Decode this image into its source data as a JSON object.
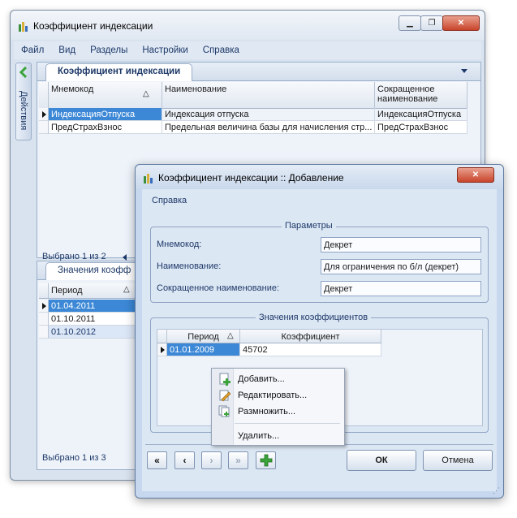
{
  "main_window": {
    "title": "Коэффициент индексации",
    "menu": [
      "Файл",
      "Вид",
      "Разделы",
      "Настройки",
      "Справка"
    ],
    "side_tab": "Действия",
    "top_panel": {
      "tab": "Коэффициент индексации",
      "columns": [
        "Мнемокод",
        "Наименование",
        "Сокращенное наименование"
      ],
      "rows": [
        [
          "ИндексацияОтпуска",
          "Индексация отпуска",
          "ИндексацияОтпуска"
        ],
        [
          "ПредСтрахВзнос",
          "Предельная величина базы для начисления стр...",
          "ПредСтрахВзнос"
        ]
      ],
      "footer": "Выбрано 1 из 2"
    },
    "bottom_panel": {
      "tab": "Значения коэфф",
      "column": "Период",
      "rows": [
        "01.04.2011",
        "01.10.2011",
        "01.10.2012"
      ],
      "footer": "Выбрано 1 из 3"
    }
  },
  "dialog": {
    "title": "Коэффициент индексации :: Добавление",
    "menu": "Справка",
    "params_legend": "Параметры",
    "fields": [
      {
        "label": "Мнемокод:",
        "value": "Декрет"
      },
      {
        "label": "Наименование:",
        "value": "Для ограничения по б/л (декрет)"
      },
      {
        "label": "Сокращенное наименование:",
        "value": "Декрет"
      }
    ],
    "values_legend": "Значения коэффициентов",
    "values_columns": [
      "Период",
      "Коэффициент"
    ],
    "values_rows": [
      [
        "01.01.2009",
        "45702"
      ]
    ],
    "ok": "ОК",
    "cancel": "Отмена"
  },
  "context_menu": {
    "items": [
      "Добавить...",
      "Редактировать...",
      "Размножить...",
      "Удалить..."
    ]
  },
  "colors": {
    "selection": "#3c88d6",
    "accent_text": "#1e3968"
  }
}
